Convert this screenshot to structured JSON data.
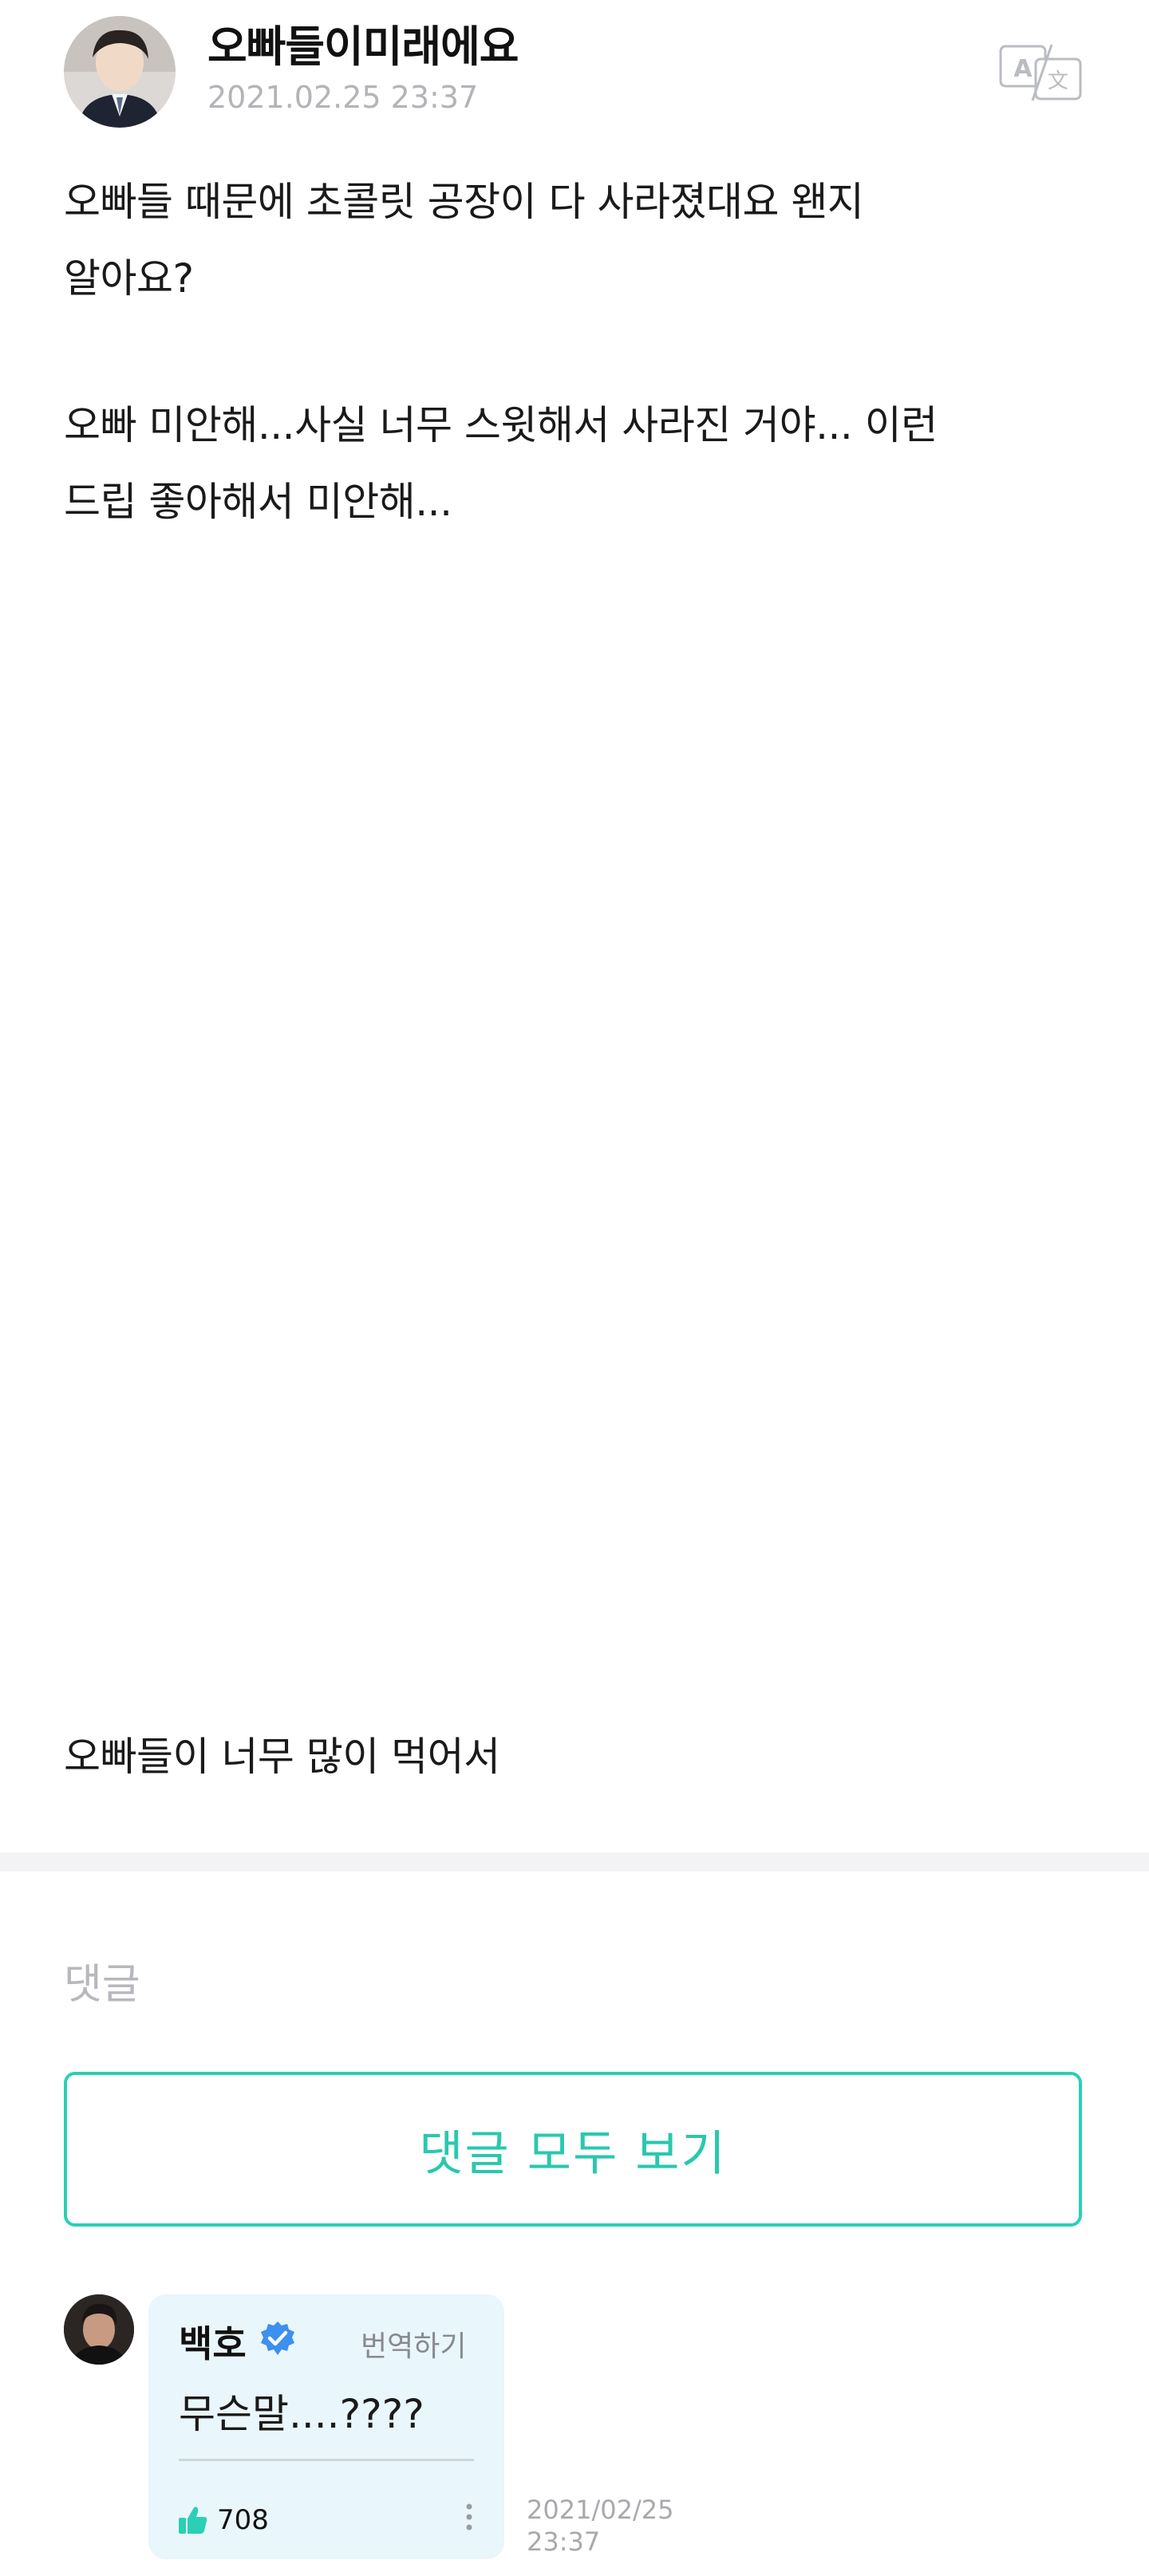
{
  "post": {
    "author": "오빠들이미래에요",
    "date": "2021.02.25 23:37",
    "paragraphs": [
      [
        "오빠들 때문에 초콜릿 공장이 다 사라졌대요 왠지",
        "알아요?"
      ],
      [
        "오빠 미안해...사실 너무 스윗해서 사라진 거야... 이런",
        "드립 좋아해서 미안해..."
      ]
    ],
    "last_line": "오빠들이 너무 많이 먹어서"
  },
  "comments_section": {
    "heading": "댓글",
    "view_all_label": "댓글 모두 보기"
  },
  "comment": {
    "author": "백호",
    "translate_label": "번역하기",
    "text": "무슨말....????",
    "likes": "708",
    "date_line1": "2021/02/25",
    "date_line2": "23:37"
  },
  "icons": {
    "translate": "translate-icon",
    "verified": "verified-badge-icon",
    "like": "thumbs-up-icon",
    "more": "more-vertical-icon"
  },
  "colors": {
    "accent": "#2ad0b4",
    "verified": "#3d8ff0",
    "bubble_bg": "#e9f6fb",
    "muted_text": "#b3b3b8"
  }
}
